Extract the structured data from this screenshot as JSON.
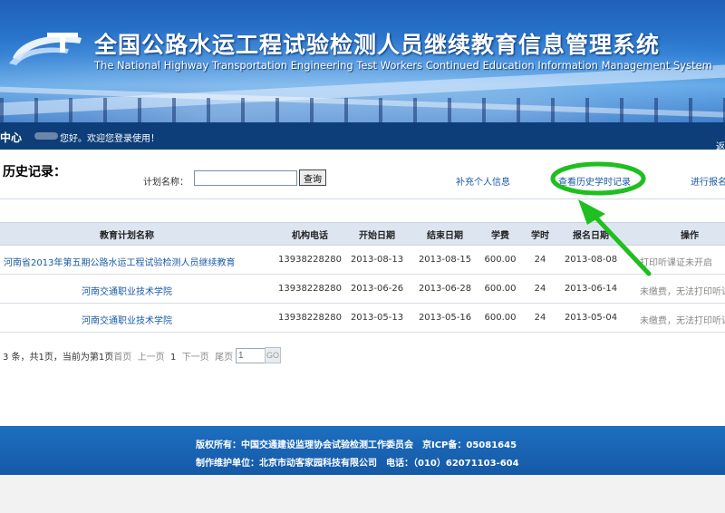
{
  "header": {
    "title_cn": "全国公路水运工程试验检测人员继续教育信息管理系统",
    "title_en": "The National Highway Transportation Engineering Test Workers Continued Education Information Management System"
  },
  "welcome_bar": {
    "center_label": "中心",
    "greeting": "您好。欢迎您登录使用！",
    "back_label": "返"
  },
  "history": {
    "title": "历史记录：",
    "plan_label": "计划名称：",
    "plan_input_value": "",
    "query_button": "查询",
    "links": {
      "supplement_info": "补充个人信息",
      "view_history_hours": "查看历史学时记录",
      "enroll": "进行报名"
    }
  },
  "table": {
    "headers": [
      "教育计划名称",
      "机构电话",
      "开始日期",
      "结束日期",
      "学费",
      "学时",
      "报名日期",
      "操作"
    ],
    "rows": [
      [
        "河南省2013年第五期公路水运工程试验检测人员继续教育",
        "13938228280",
        "2013-08-13",
        "2013-08-15",
        "600.00",
        "24",
        "2013-08-08",
        "打印听课证未开启"
      ],
      [
        "河南交通职业技术学院",
        "13938228280",
        "2013-06-26",
        "2013-06-28",
        "600.00",
        "24",
        "2013-06-14",
        "未缴费，无法打印听课证"
      ],
      [
        "河南交通职业技术学院",
        "13938228280",
        "2013-05-13",
        "2013-05-16",
        "600.00",
        "24",
        "2013-05-04",
        "未缴费，无法打印听课证"
      ]
    ]
  },
  "pager": {
    "summary": "3 条，共1页，当前为第1页",
    "first": "首页",
    "prev": "上一页",
    "current": "1",
    "next": "下一页",
    "last": "尾页",
    "page_input": "1",
    "go": "GO"
  },
  "footer": {
    "line1": "版权所有：中国交通建设监理协会试验检测工作委员会　京ICP备：05081645",
    "line2": "制作维护单位：北京市动客家园科技有限公司　电话：（010）62071103-604"
  },
  "colors": {
    "header_blue": "#2e7fd4",
    "nav_dark": "#0d3e7a",
    "link_blue": "#1a5aa6",
    "annotation_green": "#1fbf1f"
  }
}
